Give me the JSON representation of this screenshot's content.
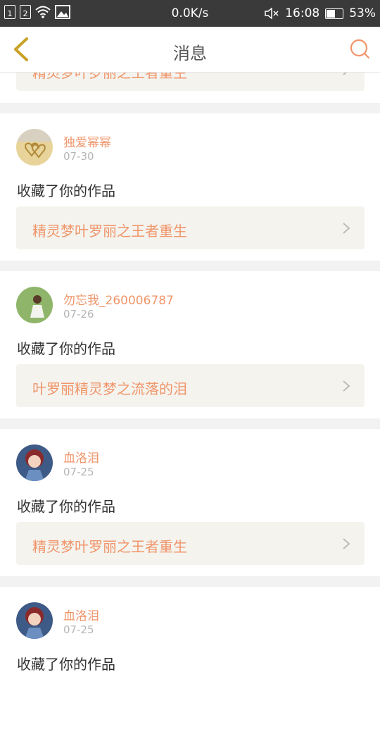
{
  "status_bar": {
    "sim1": "1",
    "sim2": "2",
    "speed": "0.0K/s",
    "time": "16:08",
    "battery": "53%"
  },
  "header": {
    "title": "消息",
    "back_icon": "chevron-left-icon",
    "search_icon": "search-icon"
  },
  "colors": {
    "accent": "#f0956a",
    "back_arrow": "#c9a227",
    "link_bg": "#f4f3ee"
  },
  "top_partial": {
    "link": "精灵梦叶罗丽之王者重生"
  },
  "messages": [
    {
      "user": "独爱幂幂",
      "date": "07-30",
      "action": "收藏了你的作品",
      "link": "精灵梦叶罗丽之王者重生"
    },
    {
      "user": "勿忘我_260006787",
      "date": "07-26",
      "action": "收藏了你的作品",
      "link": "叶罗丽精灵梦之流落的泪"
    },
    {
      "user": "血洛泪",
      "date": "07-25",
      "action": "收藏了你的作品",
      "link": "精灵梦叶罗丽之王者重生"
    },
    {
      "user": "血洛泪",
      "date": "07-25",
      "action": "收藏了你的作品",
      "link": ""
    }
  ]
}
